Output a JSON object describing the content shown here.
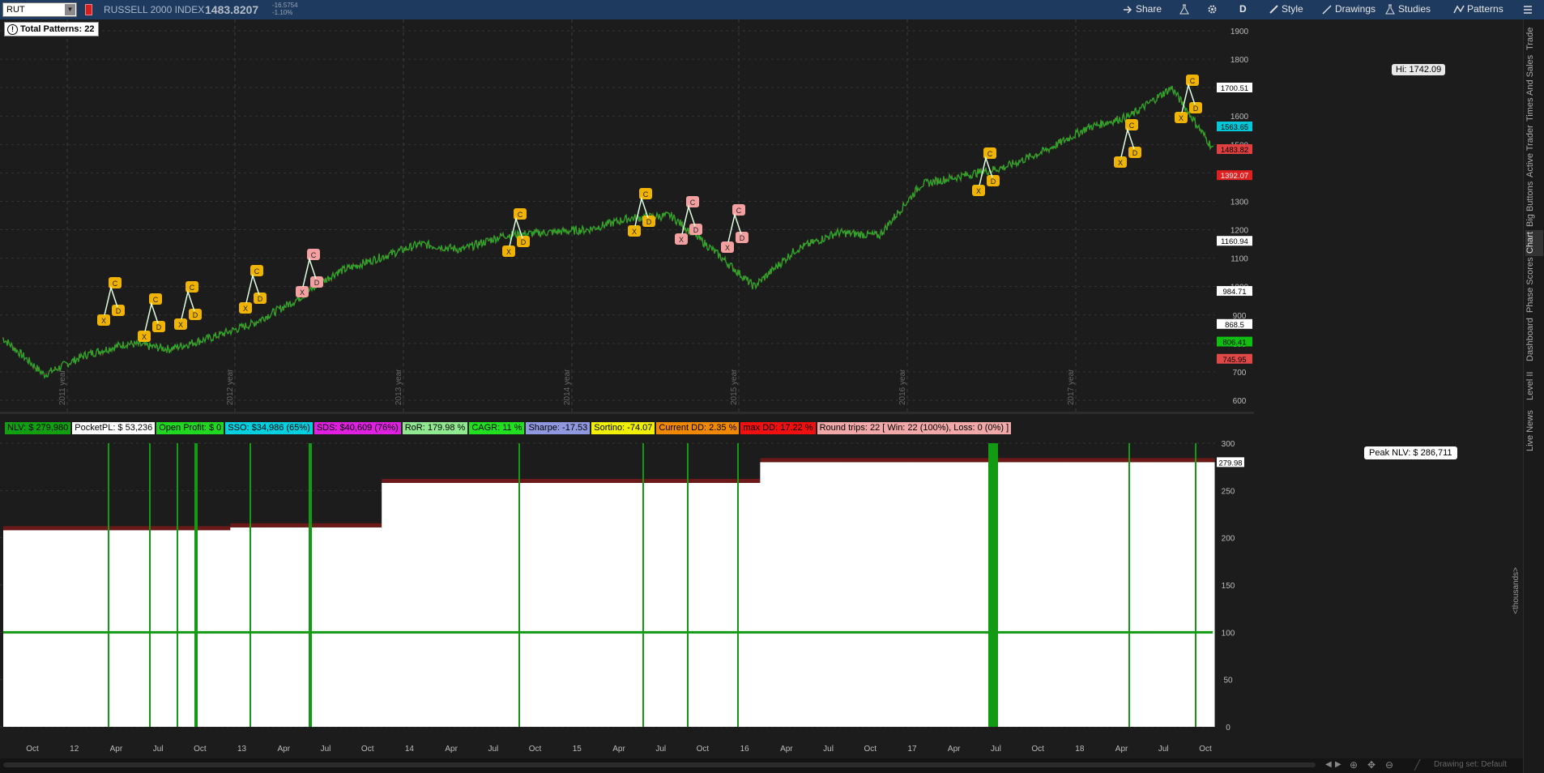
{
  "symbol": {
    "value": "RUT"
  },
  "instrument": {
    "name": "RUSSELL 2000 INDEX",
    "last": "1483.8207",
    "change": "-16.5754",
    "change_pct": "-1.10%"
  },
  "toolbar": {
    "share": "Share",
    "aggregation": "D",
    "style": "Style",
    "drawings": "Drawings",
    "studies": "Studies",
    "patterns": "Patterns"
  },
  "patterns_badge": {
    "label": "Total Patterns:",
    "count": "22"
  },
  "price_axis": {
    "ticks": [
      "1900",
      "1800",
      "1700",
      "1600",
      "1500",
      "1400",
      "1300",
      "1200",
      "1100",
      "1000",
      "900",
      "800",
      "700",
      "600"
    ],
    "markers": [
      {
        "text": "1700.51",
        "bg": "#ffffff",
        "fg": "#000000"
      },
      {
        "text": "1563.65",
        "bg": "#00c8d8",
        "fg": "#000000"
      },
      {
        "text": "1483.82",
        "bg": "#e04040",
        "fg": "#000000"
      },
      {
        "text": "1392.07",
        "bg": "#e02020",
        "fg": "#ffffff"
      },
      {
        "text": "1160.94",
        "bg": "#ffffff",
        "fg": "#000000"
      },
      {
        "text": "984.71",
        "bg": "#ffffff",
        "fg": "#000000"
      },
      {
        "text": "868.5",
        "bg": "#ffffff",
        "fg": "#000000"
      },
      {
        "text": "806.41",
        "bg": "#10c010",
        "fg": "#000000"
      },
      {
        "text": "745.95",
        "bg": "#e04848",
        "fg": "#000000"
      }
    ]
  },
  "year_labels": [
    "2011 year",
    "2012 year",
    "2013 year",
    "2014 year",
    "2015 year",
    "2016 year",
    "2017 year"
  ],
  "hi_label": "Hi: 1742.09",
  "stats": [
    {
      "text": "NLV: $ 279,980",
      "bg": "#10a010",
      "fg": "#000000"
    },
    {
      "text": "PocketPL: $ 53,236",
      "bg": "#ffffff",
      "fg": "#000000"
    },
    {
      "text": "Open Profit: $ 0",
      "bg": "#20d820",
      "fg": "#000000"
    },
    {
      "text": "SSO: $34,986 (65%)",
      "bg": "#00d0e0",
      "fg": "#000000"
    },
    {
      "text": "SDS: $40,609 (76%)",
      "bg": "#e020e0",
      "fg": "#000000"
    },
    {
      "text": "RoR: 179.98 %",
      "bg": "#90e890",
      "fg": "#000000"
    },
    {
      "text": "CAGR: 11 %",
      "bg": "#20e020",
      "fg": "#000000"
    },
    {
      "text": "Sharpe: -17.53",
      "bg": "#9098e0",
      "fg": "#000000"
    },
    {
      "text": "Sortino: -74.07",
      "bg": "#f0f000",
      "fg": "#000000"
    },
    {
      "text": "Current DD: 2.35 %",
      "bg": "#f08800",
      "fg": "#000000"
    },
    {
      "text": "max DD: 17.22 %",
      "bg": "#f01010",
      "fg": "#000000"
    },
    {
      "text": "Round trips: 22 [ Win: 22 (100%), Loss: 0 (0%) ]",
      "bg": "#f0a8a8",
      "fg": "#000000"
    }
  ],
  "peak_label": "Peak NLV: $ 286,711",
  "pl_axis": {
    "ticks": [
      "300",
      "250",
      "200",
      "150",
      "100",
      "50",
      "0"
    ],
    "marker": "279.98",
    "unit": "<thousands>"
  },
  "time_axis": [
    "Oct",
    "12",
    "Apr",
    "Jul",
    "Oct",
    "13",
    "Apr",
    "Jul",
    "Oct",
    "14",
    "Apr",
    "Jul",
    "Oct",
    "15",
    "Apr",
    "Jul",
    "Oct",
    "16",
    "Apr",
    "Jul",
    "Oct",
    "17",
    "Apr",
    "Jul",
    "Oct",
    "18",
    "Apr",
    "Jul",
    "Oct"
  ],
  "right_tabs": [
    "Trade",
    "Times And Sales",
    "Active Trader",
    "Big Buttons",
    "Chart",
    "Phase Scores",
    "Dashboard",
    "Level II",
    "Live News"
  ],
  "drawing_set": "Drawing set: Default",
  "chart_data": {
    "type": "line",
    "title": "RUSSELL 2000 INDEX",
    "ylim": [
      560,
      1940
    ],
    "x": [
      "2011-07",
      "2011-10",
      "2012-01",
      "2012-04",
      "2012-07",
      "2012-10",
      "2013-01",
      "2013-04",
      "2013-07",
      "2013-10",
      "2014-01",
      "2014-04",
      "2014-07",
      "2014-10",
      "2015-01",
      "2015-04",
      "2015-07",
      "2015-10",
      "2016-01",
      "2016-04",
      "2016-07",
      "2016-10",
      "2017-01",
      "2017-04",
      "2017-07",
      "2017-10",
      "2018-01",
      "2018-04",
      "2018-07",
      "2018-10"
    ],
    "series": [
      {
        "values": [
          820,
          690,
          760,
          800,
          780,
          820,
          870,
          950,
          1050,
          1100,
          1150,
          1130,
          1180,
          1190,
          1200,
          1240,
          1250,
          1130,
          1000,
          1130,
          1190,
          1180,
          1360,
          1390,
          1420,
          1480,
          1560,
          1600,
          1700,
          1483
        ]
      }
    ],
    "pl_series": {
      "ylim": [
        0,
        300
      ],
      "values": [
        208,
        208,
        208,
        211,
        211,
        258,
        258,
        258,
        258,
        258,
        280,
        280,
        280,
        280,
        280,
        280
      ]
    }
  }
}
